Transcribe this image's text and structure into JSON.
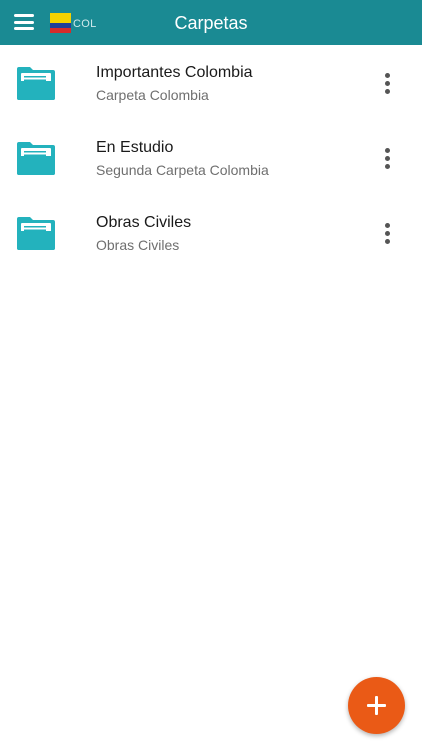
{
  "header": {
    "title": "Carpetas",
    "country_code": "COL",
    "menu_icon": "hamburger-menu-icon",
    "flag_icon": "colombia-flag-icon"
  },
  "colors": {
    "header_bg": "#1a8a93",
    "folder": "#23b2bd",
    "fab": "#ea5a16"
  },
  "folders": [
    {
      "title": "Importantes Colombia",
      "subtitle": "Carpeta Colombia"
    },
    {
      "title": "En Estudio",
      "subtitle": "Segunda Carpeta Colombia"
    },
    {
      "title": "Obras Civiles",
      "subtitle": "Obras Civiles"
    }
  ],
  "fab": {
    "icon": "plus-icon"
  }
}
